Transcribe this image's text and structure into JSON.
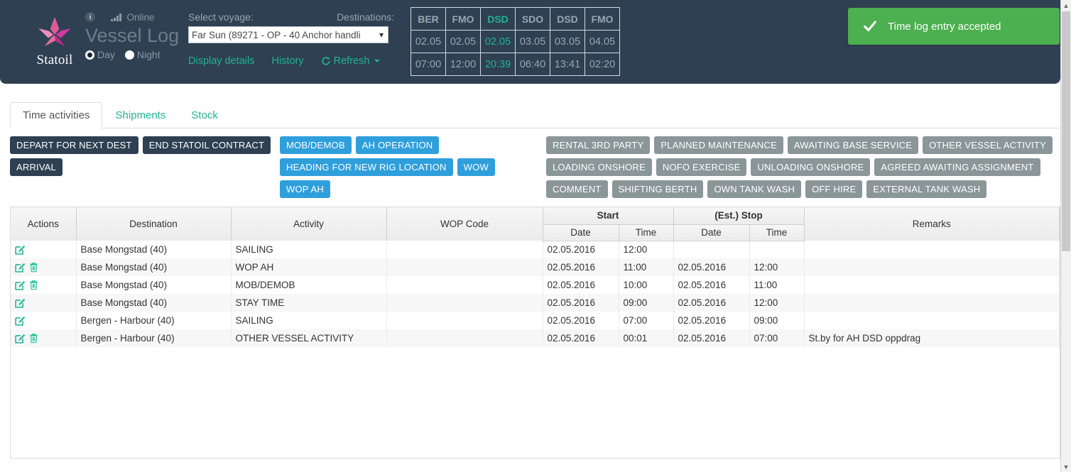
{
  "header": {
    "brand_name": "Statoil",
    "logo_icon": "statoil-star-icon",
    "info_icon": "info-icon",
    "signal_icon": "signal-bars-icon",
    "online_status": "Online",
    "app_title": "Vessel Log",
    "day_label": "Day",
    "night_label": "Night",
    "day_selected": true,
    "select_voyage_label": "Select voyage:",
    "destinations_label": "Destinations:",
    "voyage_value": "Far Sun (89271 - OP - 40 Anchor handli",
    "links": [
      {
        "label": "Display details",
        "name": "display-details-link"
      },
      {
        "label": "History",
        "name": "history-link"
      },
      {
        "label": "Refresh",
        "name": "refresh-link"
      }
    ],
    "accent_color": "#21b395",
    "background_color": "#2e4052",
    "destinations": {
      "codes": [
        "BER",
        "FMO",
        "DSD",
        "SDO",
        "DSD",
        "FMO"
      ],
      "dates": [
        "02.05",
        "02.05",
        "02.05",
        "03.05",
        "03.05",
        "04.05"
      ],
      "times": [
        "07:00",
        "12:00",
        "20:39",
        "06:40",
        "13:41",
        "02:20"
      ],
      "active_index": 2
    }
  },
  "toast": {
    "message": "Time log entry accepted",
    "icon": "check-icon",
    "color": "#4caf50"
  },
  "tabs": [
    {
      "label": "Time activities",
      "active": true
    },
    {
      "label": "Shipments",
      "active": false
    },
    {
      "label": "Stock",
      "active": false
    }
  ],
  "buttons": {
    "dark": [
      "DEPART FOR NEXT DEST",
      "END STATOIL CONTRACT",
      "ARRIVAL"
    ],
    "blue": [
      "MOB/DEMOB",
      "AH OPERATION",
      "HEADING FOR NEW RIG LOCATION",
      "WOW",
      "WOP AH"
    ],
    "gray": [
      "RENTAL 3RD PARTY",
      "PLANNED MAINTENANCE",
      "AWAITING BASE SERVICE",
      "OTHER VESSEL ACTIVITY",
      "LOADING ONSHORE",
      "NOFO EXERCISE",
      "UNLOADING ONSHORE",
      "AGREED AWAITING ASSIGNMENT",
      "COMMENT",
      "SHIFTING BERTH",
      "OWN TANK WASH",
      "OFF HIRE",
      "EXTERNAL TANK WASH"
    ]
  },
  "table": {
    "headers": {
      "actions": "Actions",
      "destination": "Destination",
      "activity": "Activity",
      "wop_code": "WOP Code",
      "start": "Start",
      "stop": "(Est.) Stop",
      "date": "Date",
      "time": "Time",
      "remarks": "Remarks"
    },
    "rows": [
      {
        "edit": true,
        "delete": false,
        "destination": "Base Mongstad (40)",
        "activity": "SAILING",
        "wop_code": "",
        "start_date": "02.05.2016",
        "start_time": "12:00",
        "stop_date": "",
        "stop_time": "",
        "remarks": ""
      },
      {
        "edit": true,
        "delete": true,
        "destination": "Base Mongstad (40)",
        "activity": "WOP AH",
        "wop_code": "",
        "start_date": "02.05.2016",
        "start_time": "11:00",
        "stop_date": "02.05.2016",
        "stop_time": "12:00",
        "remarks": ""
      },
      {
        "edit": true,
        "delete": true,
        "destination": "Base Mongstad (40)",
        "activity": "MOB/DEMOB",
        "wop_code": "",
        "start_date": "02.05.2016",
        "start_time": "10:00",
        "stop_date": "02.05.2016",
        "stop_time": "11:00",
        "remarks": ""
      },
      {
        "edit": true,
        "delete": false,
        "destination": "Base Mongstad (40)",
        "activity": "STAY TIME",
        "wop_code": "",
        "start_date": "02.05.2016",
        "start_time": "09:00",
        "stop_date": "02.05.2016",
        "stop_time": "12:00",
        "remarks": ""
      },
      {
        "edit": true,
        "delete": false,
        "destination": "Bergen - Harbour (40)",
        "activity": "SAILING",
        "wop_code": "",
        "start_date": "02.05.2016",
        "start_time": "07:00",
        "stop_date": "02.05.2016",
        "stop_time": "09:00",
        "remarks": ""
      },
      {
        "edit": true,
        "delete": true,
        "destination": "Bergen - Harbour (40)",
        "activity": "OTHER VESSEL ACTIVITY",
        "wop_code": "",
        "start_date": "02.05.2016",
        "start_time": "00:01",
        "stop_date": "02.05.2016",
        "stop_time": "07:00",
        "remarks": "St.by for AH DSD oppdrag"
      }
    ]
  },
  "scrollbar": {
    "up_arrow": "chevron-up-icon",
    "down_arrow": "chevron-down-icon"
  }
}
